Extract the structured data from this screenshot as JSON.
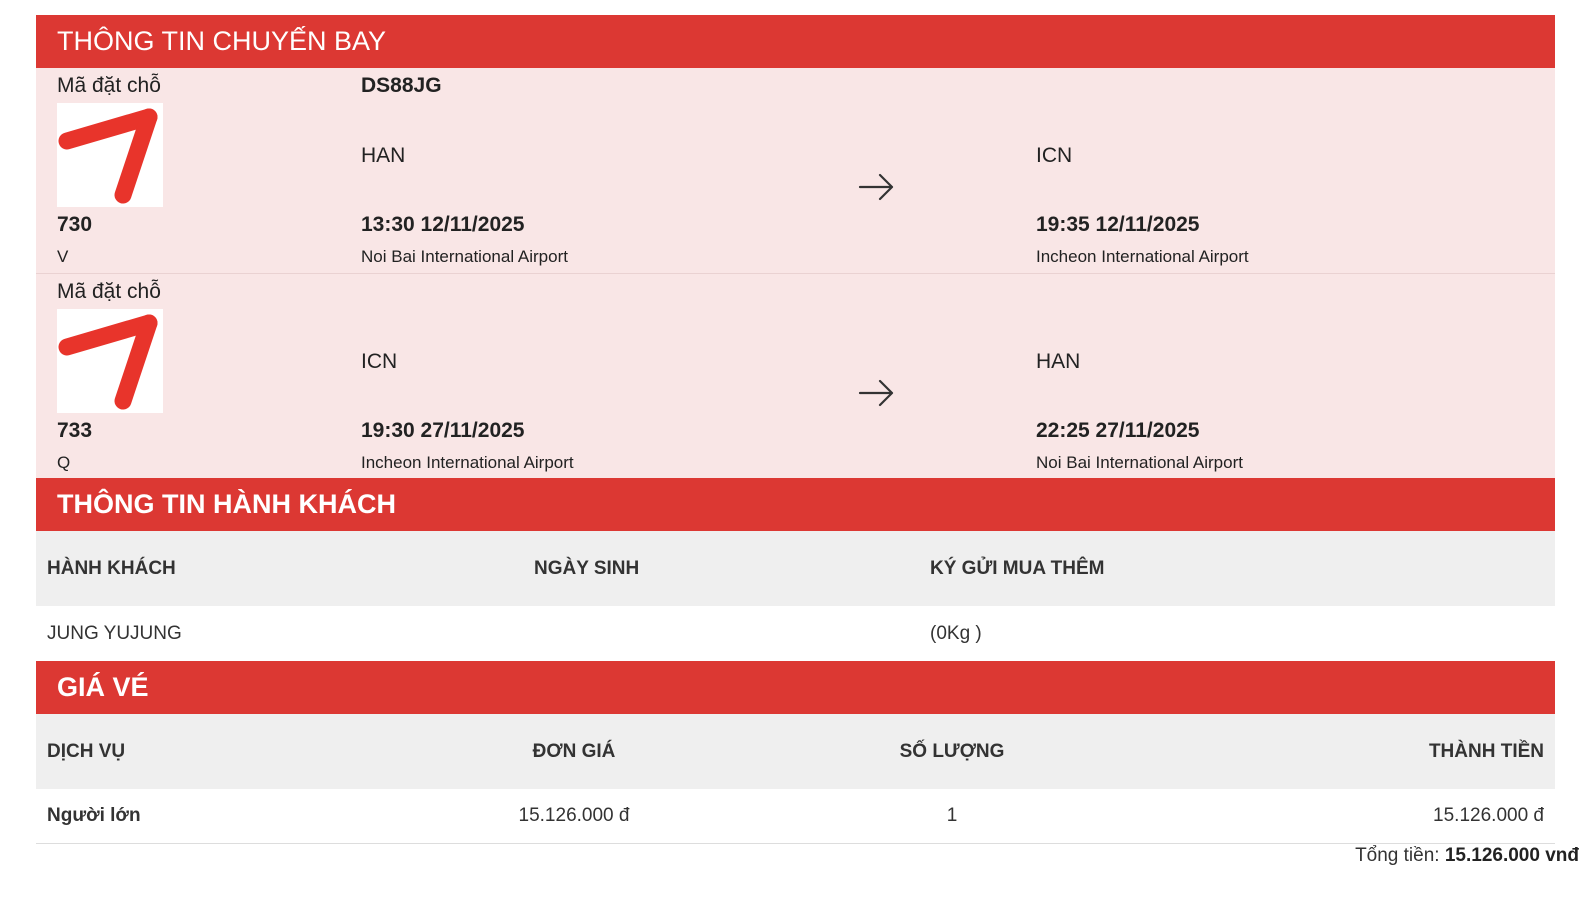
{
  "flight_section": {
    "title": "THÔNG TIN CHUYẾN BAY",
    "flights": [
      {
        "booking_label": "Mã đặt chỗ",
        "booking_code": "DS88JG",
        "airline_logo": "tway-logo",
        "flight_number": "730",
        "fare_class": "V",
        "from_code": "HAN",
        "from_time": "13:30 12/11/2025",
        "from_airport": "Noi Bai International Airport",
        "to_code": "ICN",
        "to_time": "19:35 12/11/2025",
        "to_airport": "Incheon International Airport"
      },
      {
        "booking_label": "Mã đặt chỗ",
        "booking_code": "",
        "airline_logo": "tway-logo",
        "flight_number": "733",
        "fare_class": "Q",
        "from_code": "ICN",
        "from_time": "19:30 27/11/2025",
        "from_airport": "Incheon International Airport",
        "to_code": "HAN",
        "to_time": "22:25 27/11/2025",
        "to_airport": "Noi Bai International Airport"
      }
    ]
  },
  "passenger_section": {
    "title": "THÔNG TIN HÀNH KHÁCH",
    "headers": [
      "HÀNH KHÁCH",
      "NGÀY SINH",
      "KÝ GỬI MUA THÊM"
    ],
    "rows": [
      [
        "JUNG YUJUNG",
        "",
        "(0Kg )"
      ]
    ]
  },
  "price_section": {
    "title": "GIÁ VÉ",
    "headers": [
      "DỊCH VỤ",
      "ĐƠN GIÁ",
      "SỐ LƯỢNG",
      "THÀNH TIỀN"
    ],
    "rows": [
      [
        "Người lớn",
        "15.126.000 đ",
        "1",
        "15.126.000 đ"
      ]
    ],
    "total_label": "Tổng tiền:",
    "total_value": "15.126.000 vnđ"
  },
  "colors": {
    "accent": "#dc3833",
    "flight_bg": "#f9e6e6",
    "header_row_bg": "#efefef"
  }
}
